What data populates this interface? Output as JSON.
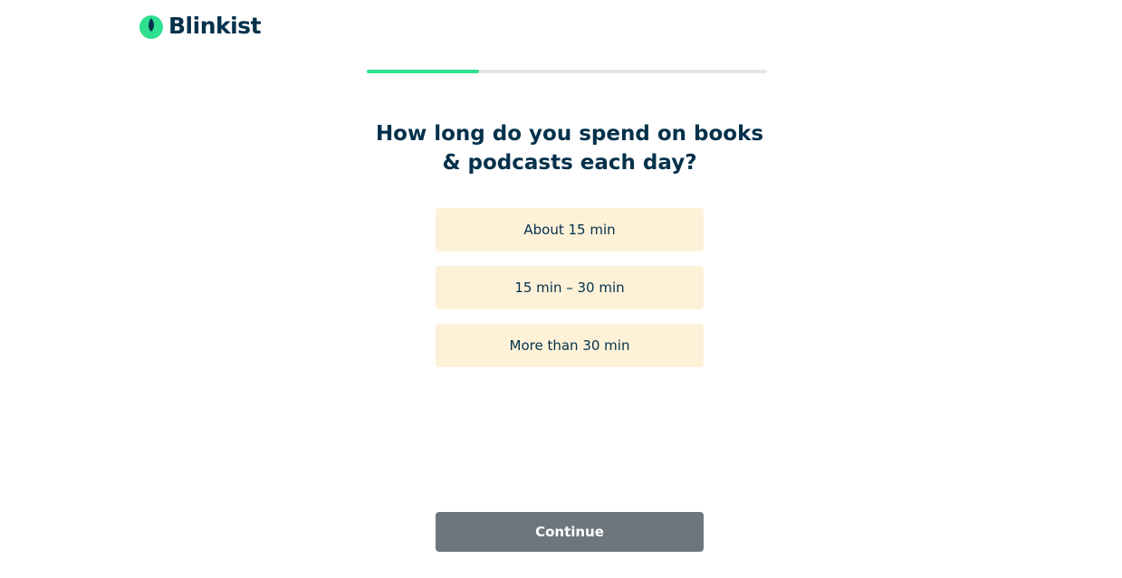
{
  "brand": {
    "name": "Blinkist",
    "logo_icon": "blinkist-leaf-icon",
    "color": "#2ee08f",
    "text_color": "#03314b"
  },
  "progress": {
    "fraction": 0.28,
    "fill_color": "#2ee08f",
    "track_color": "#e6e6e6"
  },
  "question": {
    "text": "How long do you spend on books & podcasts each day?"
  },
  "options": [
    {
      "label": "About 15 min"
    },
    {
      "label": "15 min – 30 min"
    },
    {
      "label": "More than 30 min"
    }
  ],
  "option_bg_color": "#fdf1d8",
  "continue_button": {
    "label": "Continue",
    "bg_color": "#6d767d"
  }
}
